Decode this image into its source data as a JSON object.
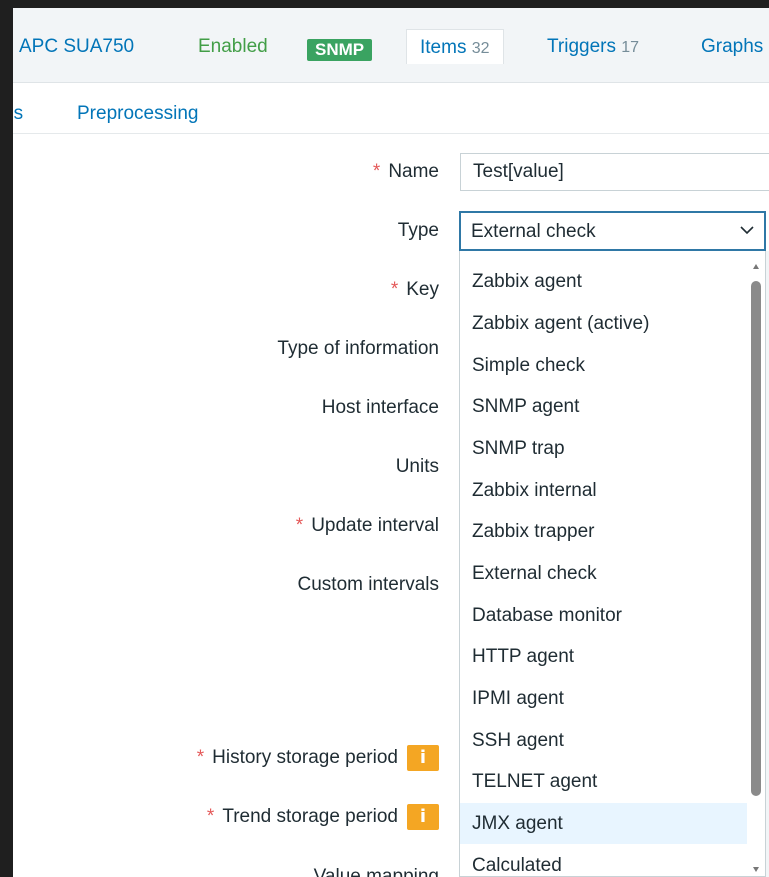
{
  "header": {
    "host": "APC SUA750",
    "status": "Enabled",
    "snmp_badge": "SNMP",
    "tabs": [
      {
        "label": "Items",
        "count": "32"
      },
      {
        "label": "Triggers",
        "count": "17"
      },
      {
        "label": "Graphs",
        "count": ""
      }
    ]
  },
  "subnav": {
    "tags_partial": "gs",
    "preprocessing": "Preprocessing"
  },
  "form": {
    "name_label": "Name",
    "name_value": "Test[value]",
    "type_label": "Type",
    "type_value": "External check",
    "key_label": "Key",
    "type_of_information_label": "Type of information",
    "host_interface_label": "Host interface",
    "units_label": "Units",
    "update_interval_label": "Update interval",
    "custom_intervals_label": "Custom intervals",
    "history_label": "History storage period",
    "trend_label": "Trend storage period",
    "value_mapping_label": "Value mapping",
    "required_mark": "*",
    "info_mark": "i"
  },
  "dropdown": {
    "options": [
      "Zabbix agent",
      "Zabbix agent (active)",
      "Simple check",
      "SNMP agent",
      "SNMP trap",
      "Zabbix internal",
      "Zabbix trapper",
      "External check",
      "Database monitor",
      "HTTP agent",
      "IPMI agent",
      "SSH agent",
      "TELNET agent",
      "JMX agent",
      "Calculated"
    ],
    "highlighted": "JMX agent"
  },
  "colors": {
    "link": "#0275b8",
    "enabled": "#429e47",
    "snmp_badge": "#3aa361",
    "required": "#e45959",
    "info": "#f4a623",
    "highlight": "#e8f5ff"
  }
}
